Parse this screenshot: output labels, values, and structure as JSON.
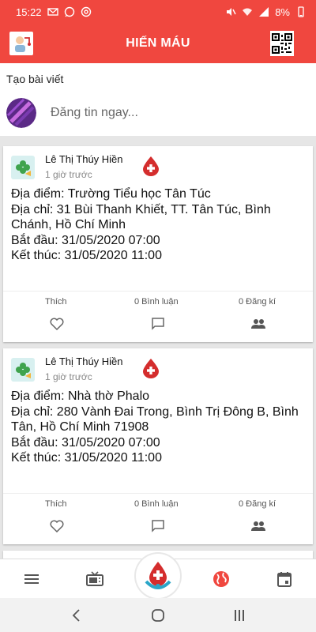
{
  "status_bar": {
    "time": "15:22",
    "battery": "8%",
    "icons": [
      "mail-icon",
      "whatsapp-icon",
      "at-sign-icon",
      "mute-icon",
      "wifi-icon",
      "signal-icon",
      "battery-icon"
    ]
  },
  "app_bar": {
    "title": "HIẾN MÁU",
    "left_icon": "user-avatar-icon",
    "right_icon": "qr-code-icon"
  },
  "create_post": {
    "label": "Tạo bài viết",
    "placeholder": "Đăng tin ngay..."
  },
  "posts": [
    {
      "author": "Lê Thị Thúy Hiền",
      "time": "1 giờ trước",
      "lines": [
        "Địa điểm: Trường Tiểu học Tân Túc",
        "Địa chỉ: 31 Bùi Thanh Khiết, TT. Tân Túc, Bình Chánh, Hồ Chí Minh",
        "Bắt đầu: 31/05/2020 07:00",
        "Kết thúc: 31/05/2020 11:00"
      ],
      "like_label": "Thích",
      "comments": "0 Bình luận",
      "registrations": "0 Đăng kí"
    },
    {
      "author": "Lê Thị Thúy Hiền",
      "time": "1 giờ trước",
      "lines": [
        "Địa điểm: Nhà thờ Phalo",
        "Địa chỉ: 280 Vành Đai Trong, Bình Trị Đông B, Bình Tân, Hồ Chí Minh 71908",
        "Bắt đầu: 31/05/2020 07:00",
        "Kết thúc: 31/05/2020 11:00"
      ],
      "like_label": "Thích",
      "comments": "0 Bình luận",
      "registrations": "0 Đăng kí"
    }
  ],
  "bottom_nav": {
    "items": [
      "menu-icon",
      "tv-icon",
      "blood-donation-logo",
      "globe-icon",
      "calendar-icon"
    ],
    "active": "globe-icon",
    "accent": "#f0473f"
  },
  "system_nav": [
    "back-icon",
    "home-icon",
    "recents-icon"
  ],
  "colors": {
    "primary": "#f0473f",
    "blood": "#d42d2d"
  }
}
